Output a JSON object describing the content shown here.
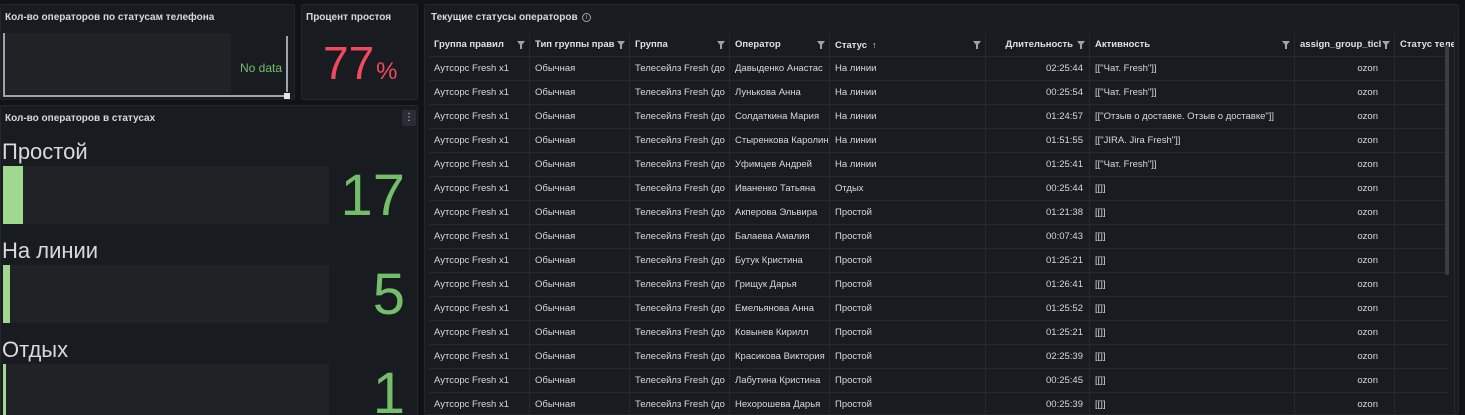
{
  "phone_panel": {
    "title": "Кол-во операторов по статусам телефона",
    "no_data": "No data"
  },
  "idle_panel": {
    "title": "Процент простоя",
    "value": "77",
    "unit": "%"
  },
  "status_panel": {
    "title": "Кол-во операторов в статусах",
    "menu_icon": "⋮",
    "items": [
      {
        "label": "Простой",
        "value": "17",
        "fraction": 0.062
      },
      {
        "label": "На линии",
        "value": "5",
        "fraction": 0.018
      },
      {
        "label": "Отдых",
        "value": "1",
        "fraction": 0.0
      }
    ]
  },
  "table_panel": {
    "title": "Текущие статусы операторов",
    "info_icon": "i",
    "columns": [
      "Группа правил",
      "Тип группы прав",
      "Группа",
      "Оператор",
      "Статус",
      "Длительность",
      "Активность",
      "assign_group_ticl",
      "Статус теле"
    ],
    "sort_icon": "↑",
    "rows": [
      [
        "Аутсорс Fresh x1",
        "Обычная",
        "Телесейлз Fresh (до",
        "Давыденко Анастас",
        "На линии",
        "02:25:44",
        "[[\"Чат. Fresh\"]]",
        "ozon"
      ],
      [
        "Аутсорс Fresh x1",
        "Обычная",
        "Телесейлз Fresh (до",
        "Лунькова Анна",
        "На линии",
        "00:25:54",
        "[[\"Чат. Fresh\"]]",
        "ozon"
      ],
      [
        "Аутсорс Fresh x1",
        "Обычная",
        "Телесейлз Fresh (до",
        "Солдаткина Мария",
        "На линии",
        "01:24:57",
        "[[\"Отзыв о доставке. Отзыв о доставке\"]]",
        "ozon"
      ],
      [
        "Аутсорс Fresh x1",
        "Обычная",
        "Телесейлз Fresh (до",
        "Стыренкова Каролин",
        "На линии",
        "01:51:55",
        "[[\"JIRA. Jira Fresh\"]]",
        "ozon"
      ],
      [
        "Аутсорс Fresh x1",
        "Обычная",
        "Телесейлз Fresh (до",
        "Уфимцев Андрей",
        "На линии",
        "01:25:41",
        "[[\"Чат. Fresh\"]]",
        "ozon"
      ],
      [
        "Аутсорс Fresh x1",
        "Обычная",
        "Телесейлз Fresh (до",
        "Иваненко Татьяна",
        "Отдых",
        "00:25:44",
        "[[]]",
        "ozon"
      ],
      [
        "Аутсорс Fresh x1",
        "Обычная",
        "Телесейлз Fresh (до",
        "Акперова Эльвира",
        "Простой",
        "01:21:38",
        "[[]]",
        "ozon"
      ],
      [
        "Аутсорс Fresh x1",
        "Обычная",
        "Телесейлз Fresh (до",
        "Балаева Амалия",
        "Простой",
        "00:07:43",
        "[[]]",
        "ozon"
      ],
      [
        "Аутсорс Fresh x1",
        "Обычная",
        "Телесейлз Fresh (до",
        "Бутук Кристина",
        "Простой",
        "01:25:21",
        "[[]]",
        "ozon"
      ],
      [
        "Аутсорс Fresh x1",
        "Обычная",
        "Телесейлз Fresh (до",
        "Грищук Дарья",
        "Простой",
        "01:26:41",
        "[[]]",
        "ozon"
      ],
      [
        "Аутсорс Fresh x1",
        "Обычная",
        "Телесейлз Fresh (до",
        "Емельянова Анна",
        "Простой",
        "01:25:52",
        "[[]]",
        "ozon"
      ],
      [
        "Аутсорс Fresh x1",
        "Обычная",
        "Телесейлз Fresh (до",
        "Ковынев Кирилл",
        "Простой",
        "01:25:21",
        "[[]]",
        "ozon"
      ],
      [
        "Аутсорс Fresh x1",
        "Обычная",
        "Телесейлз Fresh (до",
        "Красикова Виктория",
        "Простой",
        "02:25:39",
        "[[]]",
        "ozon"
      ],
      [
        "Аутсорс Fresh x1",
        "Обычная",
        "Телесейлз Fresh (до",
        "Лабутина Кристина",
        "Простой",
        "00:25:45",
        "[[]]",
        "ozon"
      ],
      [
        "Аутсорс Fresh x1",
        "Обычная",
        "Телесейлз Fresh (до",
        "Нехорошева Дарья",
        "Простой",
        "00:25:39",
        "[[]]",
        "ozon"
      ]
    ]
  },
  "colors": {
    "accent_green": "#73bf69",
    "alert_red": "#f2495c",
    "bar_fill": "#9fd88f"
  }
}
